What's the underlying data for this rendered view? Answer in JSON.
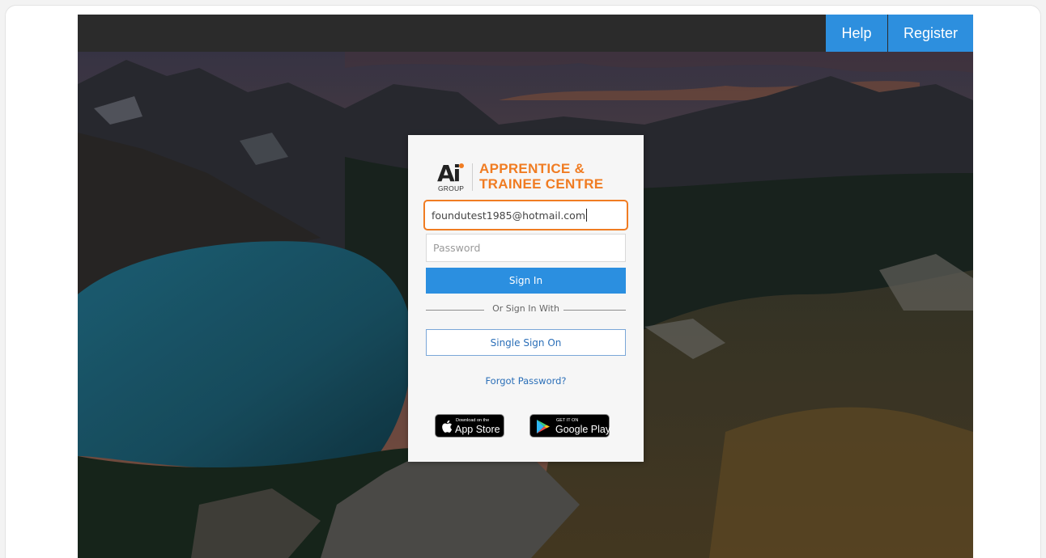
{
  "header": {
    "help_label": "Help",
    "register_label": "Register"
  },
  "logo": {
    "mark": "Ai",
    "group_label": "GROUP",
    "line1": "APPRENTICE &",
    "line2": "TRAINEE CENTRE"
  },
  "login": {
    "email_value": "foundutest1985@hotmail.com",
    "password_placeholder": "Password",
    "signin_label": "Sign In",
    "divider_label": "Or Sign In With",
    "sso_label": "Single Sign On",
    "forgot_label": "Forgot Password?"
  },
  "stores": {
    "apple_small": "Download on the",
    "apple_big": "App Store",
    "google_small": "GET IT ON",
    "google_big": "Google Play"
  },
  "colors": {
    "accent_blue": "#2d8fde",
    "brand_orange": "#f07c22",
    "topbar": "#2b2b2b"
  }
}
